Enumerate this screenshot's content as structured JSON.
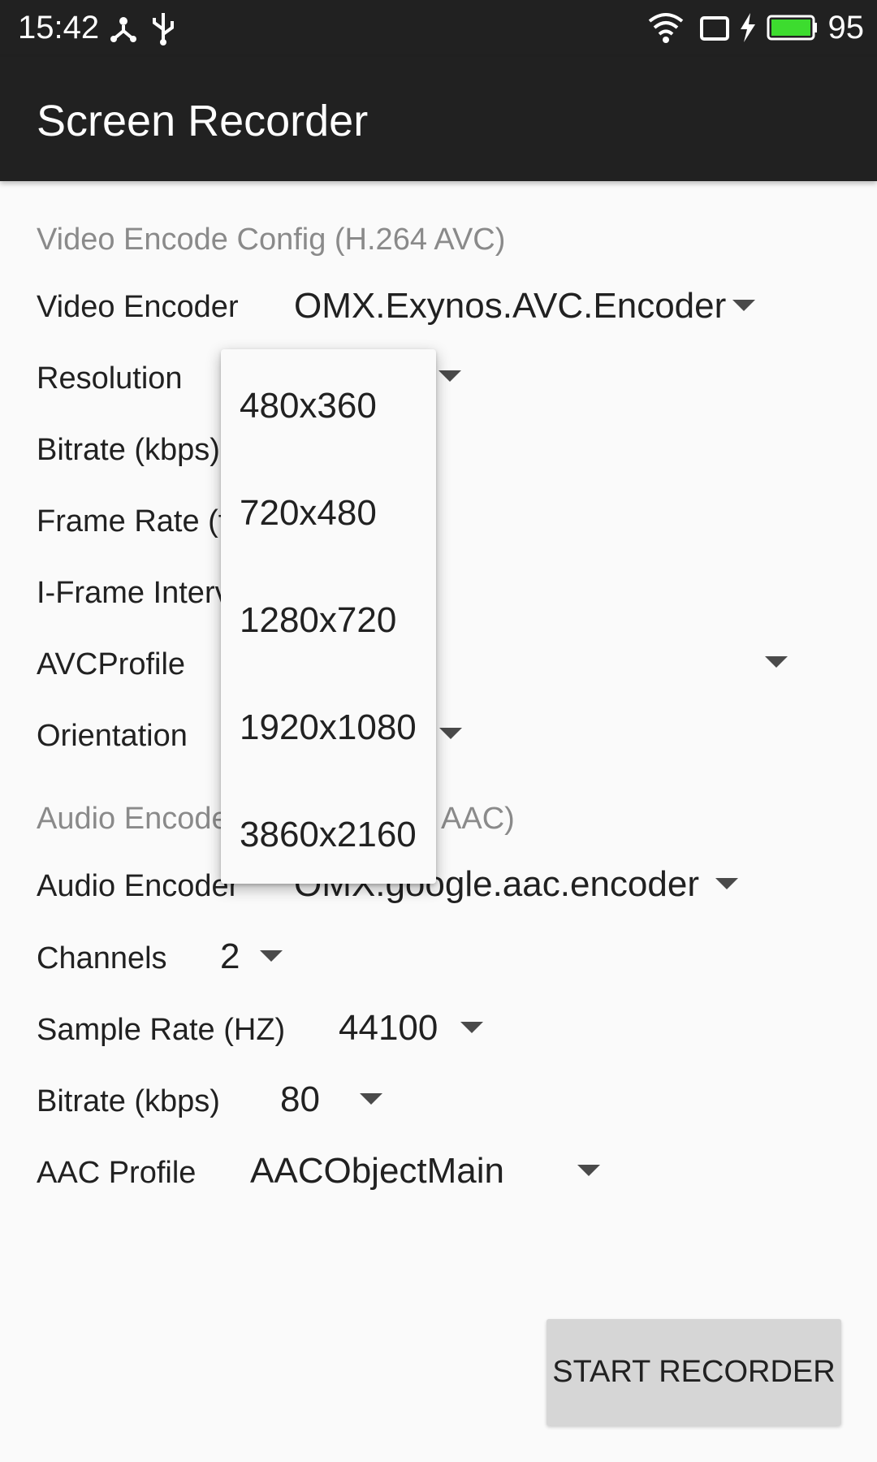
{
  "status_bar": {
    "time": "15:42",
    "battery_pct": "95"
  },
  "app_bar": {
    "title": "Screen Recorder"
  },
  "video_section": {
    "title": "Video Encode Config (H.264 AVC)",
    "rows": {
      "encoder": {
        "label": "Video Encoder",
        "value": "OMX.Exynos.AVC.Encoder"
      },
      "resolution": {
        "label": "Resolution"
      },
      "bitrate": {
        "label": "Bitrate (kbps)"
      },
      "framerate": {
        "label": "Frame Rate (f"
      },
      "iframe": {
        "label": "I-Frame Interv"
      },
      "profile": {
        "label": "AVCProfile"
      },
      "orientation": {
        "label": "Orientation"
      }
    }
  },
  "audio_section": {
    "title_left": "Audio Encode",
    "title_right": "AAC)",
    "rows": {
      "encoder": {
        "label": "Audio Encoder",
        "value": "OMX.google.aac.encoder"
      },
      "channels": {
        "label": "Channels",
        "value": "2"
      },
      "samplerate": {
        "label": "Sample Rate (HZ)",
        "value": "44100"
      },
      "bitrate": {
        "label": "Bitrate (kbps)",
        "value": "80"
      },
      "aacprofile": {
        "label": "AAC Profile",
        "value": "AACObjectMain"
      }
    }
  },
  "resolution_dropdown": {
    "options": [
      "480x360",
      "720x480",
      "1280x720",
      "1920x1080",
      "3860x2160"
    ]
  },
  "start_button": {
    "label": "START RECORDER"
  }
}
